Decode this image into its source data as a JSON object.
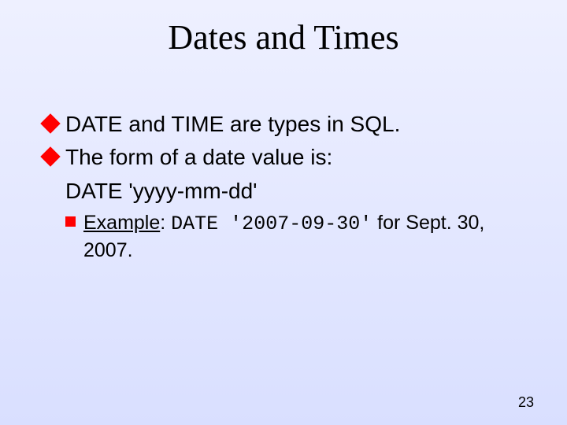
{
  "title": "Dates and Times",
  "bullets": {
    "b1": "DATE and TIME are types in SQL.",
    "b2": "The form of a date value is:",
    "b2_sub": "DATE 'yyyy-mm-dd'"
  },
  "example": {
    "label": "Example",
    "sep": ": ",
    "code": "DATE '2007-09-30'",
    "tail": " for Sept. 30, 2007."
  },
  "page_number": "23"
}
